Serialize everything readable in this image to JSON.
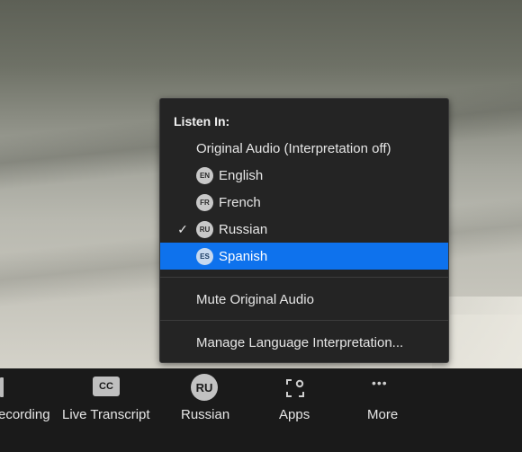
{
  "menu": {
    "heading": "Listen In:",
    "options": [
      {
        "label": "Original Audio (Interpretation off)",
        "badge": "",
        "checked": false,
        "selected": false
      },
      {
        "label": "English",
        "badge": "EN",
        "checked": false,
        "selected": false
      },
      {
        "label": "French",
        "badge": "FR",
        "checked": false,
        "selected": false
      },
      {
        "label": "Russian",
        "badge": "RU",
        "checked": true,
        "selected": false
      },
      {
        "label": "Spanish",
        "badge": "ES",
        "checked": false,
        "selected": true
      }
    ],
    "check_glyph": "✓",
    "mute_label": "Mute Original Audio",
    "manage_label": "Manage Language Interpretation..."
  },
  "toolbar": {
    "recording_label": "ecording",
    "cc_text": "CC",
    "live_transcript_label": "Live Transcript",
    "language_badge": "RU",
    "language_label": "Russian",
    "apps_label": "Apps",
    "more_glyph": "•••",
    "more_label": "More"
  },
  "colors": {
    "menu_bg": "#242424",
    "selected_bg": "#0e72ed",
    "toolbar_bg": "#1a1a1a"
  }
}
